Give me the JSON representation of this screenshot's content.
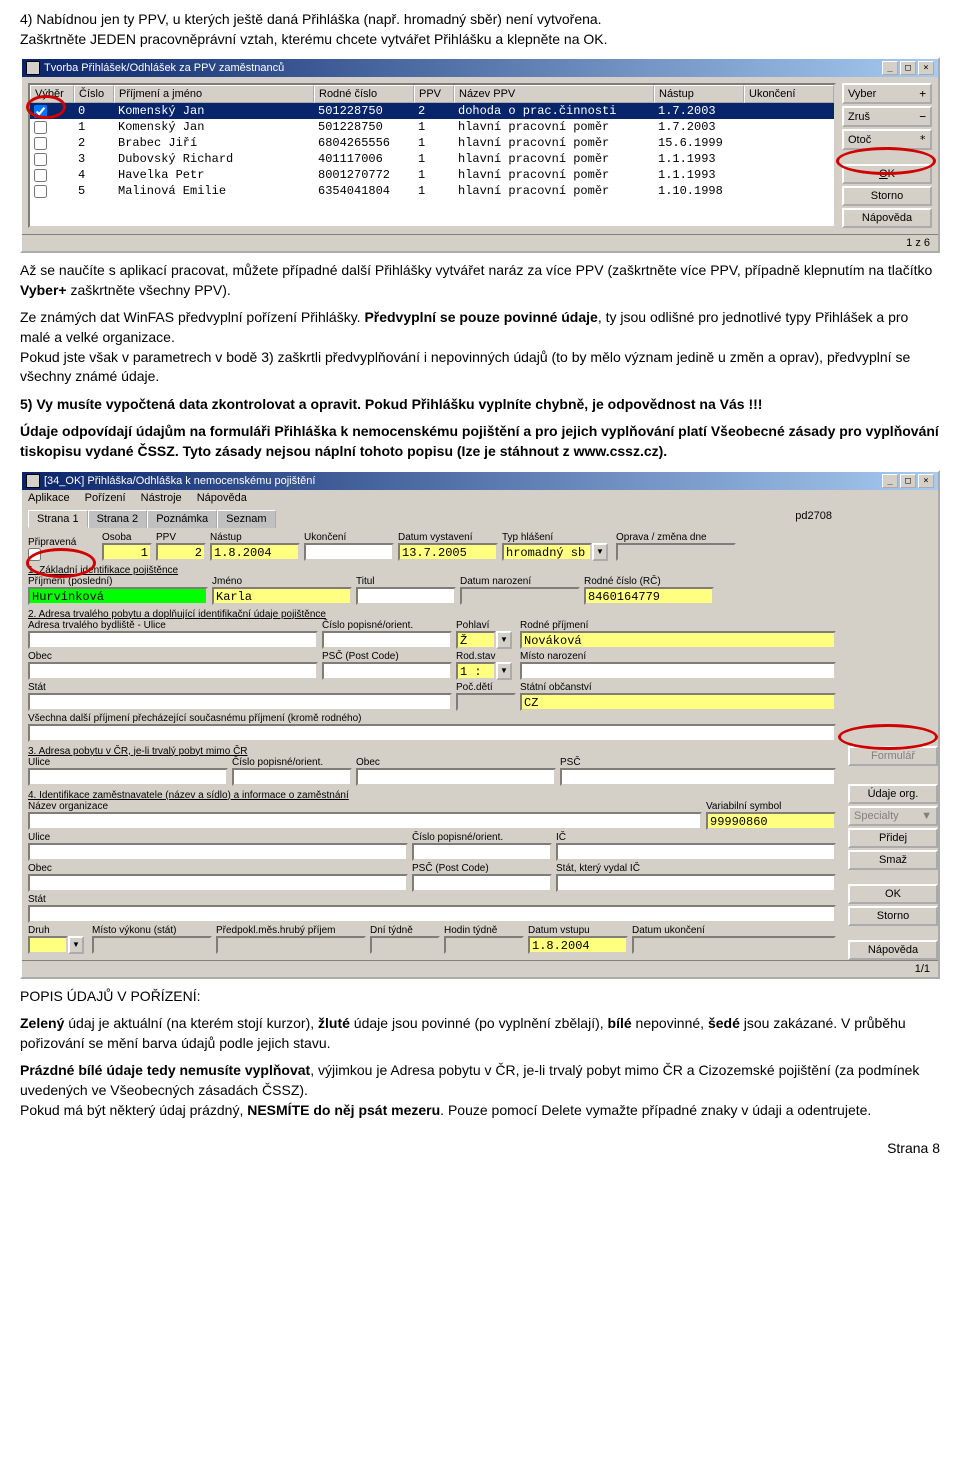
{
  "intro": {
    "line1a": "4) Nabídnou jen ty PPV, u kterých ještě daná Přihláška (např. hromadný sběr) není vytvořena.",
    "line1b": "Zaškrtněte JEDEN pracovněprávní vztah, kterému chcete vytvářet Přihlášku a klepněte na OK."
  },
  "win1": {
    "title": "Tvorba Přihlášek/Odhlášek za PPV zaměstnanců",
    "headers": {
      "vyber": "Výběr",
      "cislo": "Číslo",
      "jmeno": "Příjmení a jméno",
      "rodne": "Rodné číslo",
      "ppv": "PPV",
      "nazev": "Název PPV",
      "nastup": "Nástup",
      "ukonc": "Ukončení"
    },
    "rows": [
      {
        "checked": true,
        "cislo": "0",
        "jmeno": "Komenský Jan",
        "rodne": "501228750",
        "ppv": "2",
        "nazev": "dohoda o prac.činnosti",
        "nastup": "1.7.2003",
        "ukonc": ""
      },
      {
        "checked": false,
        "cislo": "1",
        "jmeno": "Komenský Jan",
        "rodne": "501228750",
        "ppv": "1",
        "nazev": "hlavní pracovní poměr",
        "nastup": "1.7.2003",
        "ukonc": ""
      },
      {
        "checked": false,
        "cislo": "2",
        "jmeno": "Brabec Jiří",
        "rodne": "6804265556",
        "ppv": "1",
        "nazev": "hlavní pracovní poměr",
        "nastup": "15.6.1999",
        "ukonc": ""
      },
      {
        "checked": false,
        "cislo": "3",
        "jmeno": "Dubovský Richard",
        "rodne": "401117006",
        "ppv": "1",
        "nazev": "hlavní pracovní poměr",
        "nastup": "1.1.1993",
        "ukonc": ""
      },
      {
        "checked": false,
        "cislo": "4",
        "jmeno": "Havelka Petr",
        "rodne": "8001270772",
        "ppv": "1",
        "nazev": "hlavní pracovní poměr",
        "nastup": "1.1.1993",
        "ukonc": ""
      },
      {
        "checked": false,
        "cislo": "5",
        "jmeno": "Malinová Emilie",
        "rodne": "6354041804",
        "ppv": "1",
        "nazev": "hlavní pracovní poměr",
        "nastup": "1.10.1998",
        "ukonc": ""
      }
    ],
    "buttons": {
      "vyber": "Vyber",
      "zrus": "Zruš",
      "otoc": "Otoč",
      "ok": "OK",
      "storno": "Storno",
      "napoveda": "Nápověda"
    },
    "status": "1 z 6"
  },
  "mid": {
    "p1a": "Až se naučíte s aplikací pracovat, můžete případné další Přihlášky vytvářet naráz za více PPV (zaškrtněte více PPV, případně klepnutím na tlačítko ",
    "p1b": "Vyber+",
    "p1c": " zaškrtněte všechny PPV).",
    "p2a": "Ze známých dat WinFAS předvyplní pořízení Přihlášky. ",
    "p2b": "Předvyplní se pouze povinné údaje",
    "p2c": ", ty jsou odlišné pro jednotlivé typy Přihlášek a pro malé a velké organizace.",
    "p3": "Pokud jste však v parametrech v bodě 3) zaškrtli předvyplňování i nepovinných údajů (to by mělo význam jedině u změn a oprav), předvyplní se všechny známé údaje.",
    "p4": "5) Vy musíte vypočtená data zkontrolovat a opravit. Pokud Přihlášku vyplníte chybně, je odpovědnost na Vás !!!",
    "p5": "Údaje odpovídají údajům na formuláři Přihláška k nemocenskému pojištění a pro jejich vyplňování platí Všeobecné zásady pro vyplňování tiskopisu vydané ČSSZ. Tyto zásady nejsou náplní tohoto popisu (Ize je stáhnout z www.cssz.cz)."
  },
  "win2": {
    "title": "[34_OK] Přihláška/Odhláška k nemocenskému pojištění",
    "menus": {
      "aplikace": "Aplikace",
      "porizeni": "Pořízení",
      "nastroje": "Nástroje",
      "napoveda": "Nápověda"
    },
    "pd": "pd2708",
    "tabs": {
      "strana1": "Strana 1",
      "strana2": "Strana 2",
      "poznamka": "Poznámka",
      "seznam": "Seznam"
    },
    "subtabs": {
      "pripravena": "Připravená",
      "osoba": "Osoba",
      "ppv": "PPV",
      "nastup": "Nástup",
      "ukonceni": "Ukončení",
      "datum_vyst": "Datum vystavení",
      "typ_hlaseni": "Typ hlášení",
      "oprava": "Oprava / změna dne"
    },
    "row0": {
      "osoba": "1",
      "ppv": "2",
      "nastup": "1.8.2004",
      "ukonceni": "",
      "datum_vyst": "13.7.2005",
      "typ": "hromadný sb"
    },
    "sec1_title": "1. Základní identifikace pojištěnce",
    "sec1_labels": {
      "prijmeni": "Příjmení (poslední)",
      "jmeno": "Jméno",
      "titul": "Titul",
      "datum_nar": "Datum narození",
      "rodne": "Rodné číslo (RČ)"
    },
    "sec1_vals": {
      "prijmeni": "Hurvínková",
      "jmeno": "Karla",
      "titul": "",
      "datum_nar": "",
      "rodne": "8460164779"
    },
    "sec2_title": "2. Adresa trvalého pobytu a doplňující identifikační údaje pojištěnce",
    "sec2_labels": {
      "ulice": "Adresa trvalého bydliště - Ulice",
      "cislo": "Číslo popisné/orient.",
      "pohlavi": "Pohlaví",
      "rodne_prij": "Rodné příjmení",
      "obec": "Obec",
      "psc": "PSČ (Post Code)",
      "rodstav": "Rod.stav",
      "misto_nar": "Místo narození",
      "stat": "Stát",
      "poc_deti": "Poč.dětí",
      "statni_obc": "Státní občanství",
      "dalsi": "Všechna další příjmení přecházející současnému příjmení (kromě rodného)"
    },
    "sec2_vals": {
      "pohlavi": "Ž",
      "rodne_prij": "Nováková",
      "rodstav": "1 :",
      "statni_obc": "CZ"
    },
    "sec3_title": "3. Adresa pobytu v ČR, je-li trvalý pobyt mimo ČR",
    "sec3_labels": {
      "ulice": "Ulice",
      "cislo": "Číslo popisné/orient.",
      "obec": "Obec",
      "psc": "PSČ"
    },
    "sec4_title": "4. Identifikace zaměstnavatele (název a sídlo) a informace o zaměstnání",
    "sec4_labels": {
      "nazev": "Název organizace",
      "varsym": "Variabilní symbol",
      "ulice": "Ulice",
      "cislo": "Číslo popisné/orient.",
      "ic": "IČ",
      "obec": "Obec",
      "psc": "PSČ (Post Code)",
      "stat_ic": "Stát, který vydal IČ",
      "stat": "Stát",
      "druh": "Druh",
      "misto_vyk": "Místo výkonu (stát)",
      "predpokl": "Předpokl.měs.hrubý příjem",
      "dni": "Dní týdně",
      "hodin": "Hodin týdně",
      "datum_vst": "Datum vstupu",
      "datum_uk": "Datum ukončení"
    },
    "sec4_vals": {
      "varsym": "99990860",
      "datum_vst": "1.8.2004"
    },
    "side": {
      "formular": "Formulář",
      "udaje": "Údaje org.",
      "specialty": "Specialty",
      "pridej": "Přidej",
      "smaz": "Smaž",
      "ok": "OK",
      "storno": "Storno",
      "napoveda": "Nápověda"
    },
    "status": "1/1"
  },
  "outro": {
    "p1_label": "POPIS ÚDAJŮ V POŘÍZENÍ:",
    "p1a": "Zelený",
    "p1b": " údaj je aktuální (na kterém stojí kurzor), ",
    "p1c": "žluté",
    "p1d": " údaje jsou povinné (po vyplnění zbělají), ",
    "p1e": "bílé",
    "p1f": " nepovinné, ",
    "p1g": "šedé",
    "p1h": " jsou zakázané. V průběhu pořizování se mění barva údajů podle jejich stavu.",
    "p2a": "Prázdné bílé údaje tedy nemusíte vyplňovat",
    "p2b": ", výjimkou je Adresa pobytu v ČR, je-li trvalý pobyt mimo ČR a Cizozemské pojištění (za podmínek uvedených ve Všeobecných zásadách ČSSZ).",
    "p3a": "Pokud má být některý údaj prázdný, ",
    "p3b": "NESMÍTE do něj psát mezeru",
    "p3c": ". Pouze pomocí Delete vymažte případné znaky v údaji a odentrujete.",
    "footer": "Strana 8"
  }
}
